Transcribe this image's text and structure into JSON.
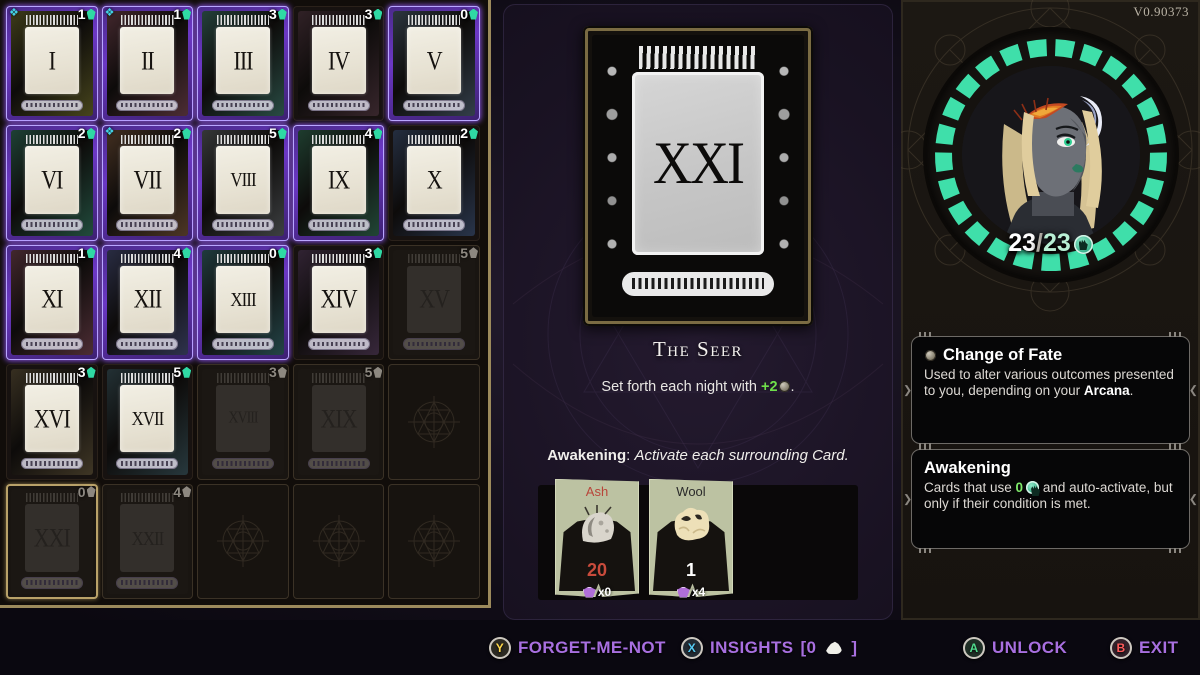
{
  "version": "V0.90373",
  "grid": {
    "cards": [
      {
        "numeral": "I",
        "cost": "1",
        "state": "owned",
        "upgraded": true
      },
      {
        "numeral": "II",
        "cost": "1",
        "state": "owned",
        "upgraded": true
      },
      {
        "numeral": "III",
        "cost": "3",
        "state": "owned",
        "upgraded": false
      },
      {
        "numeral": "IV",
        "cost": "3",
        "state": "owned-dim",
        "upgraded": false
      },
      {
        "numeral": "V",
        "cost": "0",
        "state": "owned",
        "upgraded": false
      },
      {
        "numeral": "VI",
        "cost": "2",
        "state": "owned",
        "upgraded": false
      },
      {
        "numeral": "VII",
        "cost": "2",
        "state": "owned",
        "upgraded": true
      },
      {
        "numeral": "VIII",
        "cost": "5",
        "state": "owned",
        "upgraded": false
      },
      {
        "numeral": "IX",
        "cost": "4",
        "state": "owned",
        "upgraded": false
      },
      {
        "numeral": "X",
        "cost": "2",
        "state": "owned-dim",
        "upgraded": false
      },
      {
        "numeral": "XI",
        "cost": "1",
        "state": "owned",
        "upgraded": false
      },
      {
        "numeral": "XII",
        "cost": "4",
        "state": "owned",
        "upgraded": false
      },
      {
        "numeral": "XIII",
        "cost": "0",
        "state": "owned",
        "upgraded": false
      },
      {
        "numeral": "XIV",
        "cost": "3",
        "state": "owned-dim",
        "upgraded": false
      },
      {
        "numeral": "XV",
        "cost": "5",
        "state": "locked",
        "upgraded": false
      },
      {
        "numeral": "XVI",
        "cost": "3",
        "state": "owned-dim",
        "upgraded": false
      },
      {
        "numeral": "XVII",
        "cost": "5",
        "state": "owned-dim",
        "upgraded": false
      },
      {
        "numeral": "XVIII",
        "cost": "3",
        "state": "locked",
        "upgraded": false
      },
      {
        "numeral": "XIX",
        "cost": "5",
        "state": "locked",
        "upgraded": false
      },
      {
        "numeral": "",
        "cost": "",
        "state": "empty",
        "upgraded": false
      },
      {
        "numeral": "XXI",
        "cost": "0",
        "state": "locked-selected",
        "upgraded": false
      },
      {
        "numeral": "XXII",
        "cost": "4",
        "state": "locked",
        "upgraded": false
      },
      {
        "numeral": "",
        "cost": "",
        "state": "empty",
        "upgraded": false
      },
      {
        "numeral": "",
        "cost": "",
        "state": "empty",
        "upgraded": false
      },
      {
        "numeral": "",
        "cost": "",
        "state": "empty",
        "upgraded": false
      }
    ]
  },
  "detail": {
    "numeral": "XXI",
    "title": "The Seer",
    "desc_before": "Set forth each night with ",
    "desc_value": "+2",
    "desc_after": ".",
    "awakening_label": "Awakening",
    "awakening_sep": ": ",
    "awakening_text": "Activate each surrounding Card.",
    "minicards": [
      {
        "name": "Ash",
        "count": "20",
        "name_color": "#b8453a",
        "count_color": "#c94b3c",
        "foot": "x0"
      },
      {
        "name": "Wool",
        "count": "1",
        "name_color": "#2a2a2a",
        "count_color": "#ffffff",
        "foot": "x4"
      }
    ]
  },
  "status": {
    "hp_current": "23",
    "hp_sep": "/",
    "hp_max": "23",
    "segments_total": 25,
    "segments_filled": 25,
    "segment_color": "#3fdfaa"
  },
  "tooltips": [
    {
      "title": "Change of Fate",
      "has_coin_icon": true,
      "body_parts": [
        {
          "t": "Used to alter various outcomes presented to you, depending on your ",
          "b": false
        },
        {
          "t": "Arcana",
          "b": true
        },
        {
          "t": ".",
          "b": false
        }
      ]
    },
    {
      "title": "Awakening",
      "has_coin_icon": false,
      "body_parts": [
        {
          "t": "Cards that use ",
          "b": false
        },
        {
          "t": "0",
          "b": false,
          "green": true
        },
        {
          "t": " and auto-activate, but only if their condition is met.",
          "b": false
        }
      ]
    }
  ],
  "bottom_bar": [
    {
      "glyph": "Y",
      "label": "FORGET-ME-NOT",
      "glyph_class": "g-y"
    },
    {
      "glyph": "X",
      "label": "INSIGHTS",
      "suffix_open": "[0",
      "suffix_close": "]",
      "glyph_class": "g-x"
    },
    {
      "glyph": "A",
      "label": "UNLOCK",
      "glyph_class": "g-a"
    },
    {
      "glyph": "B",
      "label": "EXIT",
      "glyph_class": "g-b"
    }
  ],
  "colors": {
    "accent_purple": "#a86fe0",
    "gold_border": "#9c8a5c",
    "teal_gem": "#2fd9a4",
    "green_value": "#6fe04a"
  }
}
